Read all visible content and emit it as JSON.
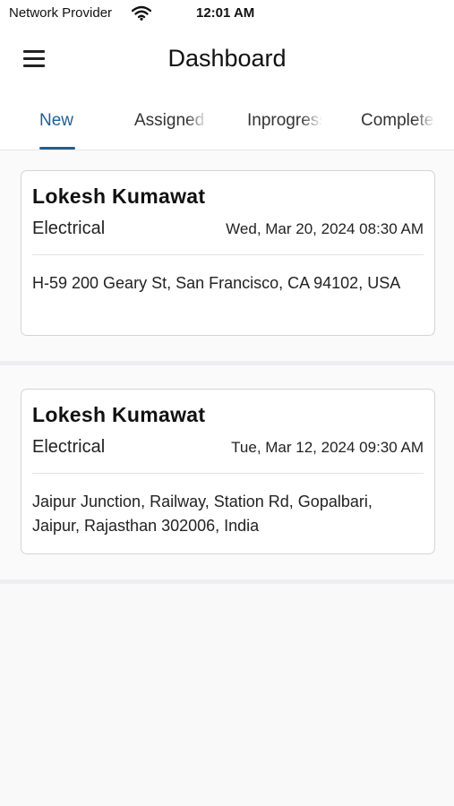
{
  "status_bar": {
    "carrier": "Network Provider",
    "time": "12:01 AM",
    "wifi_icon": "wifi-icon"
  },
  "header": {
    "menu_icon": "hamburger-menu-icon",
    "title": "Dashboard"
  },
  "tabs": [
    {
      "label": "New",
      "active": true
    },
    {
      "label": "Assigned",
      "active": false
    },
    {
      "label": "Inprogress",
      "active": false
    },
    {
      "label": "Completed",
      "active": false
    }
  ],
  "cards": [
    {
      "name": "Lokesh Kumawat",
      "category": "Electrical",
      "datetime": "Wed, Mar 20, 2024 08:30 AM",
      "address": "H-59 200 Geary St, San Francisco, CA 94102, USA"
    },
    {
      "name": "Lokesh Kumawat",
      "category": "Electrical",
      "datetime": "Tue, Mar 12, 2024 09:30 AM",
      "address": "Jaipur Junction, Railway, Station Rd, Gopalbari, Jaipur, Rajasthan 302006, India"
    }
  ],
  "colors": {
    "accent": "#1f5f96",
    "background": "#f9f9fa",
    "card_border": "#d4d4d6"
  }
}
